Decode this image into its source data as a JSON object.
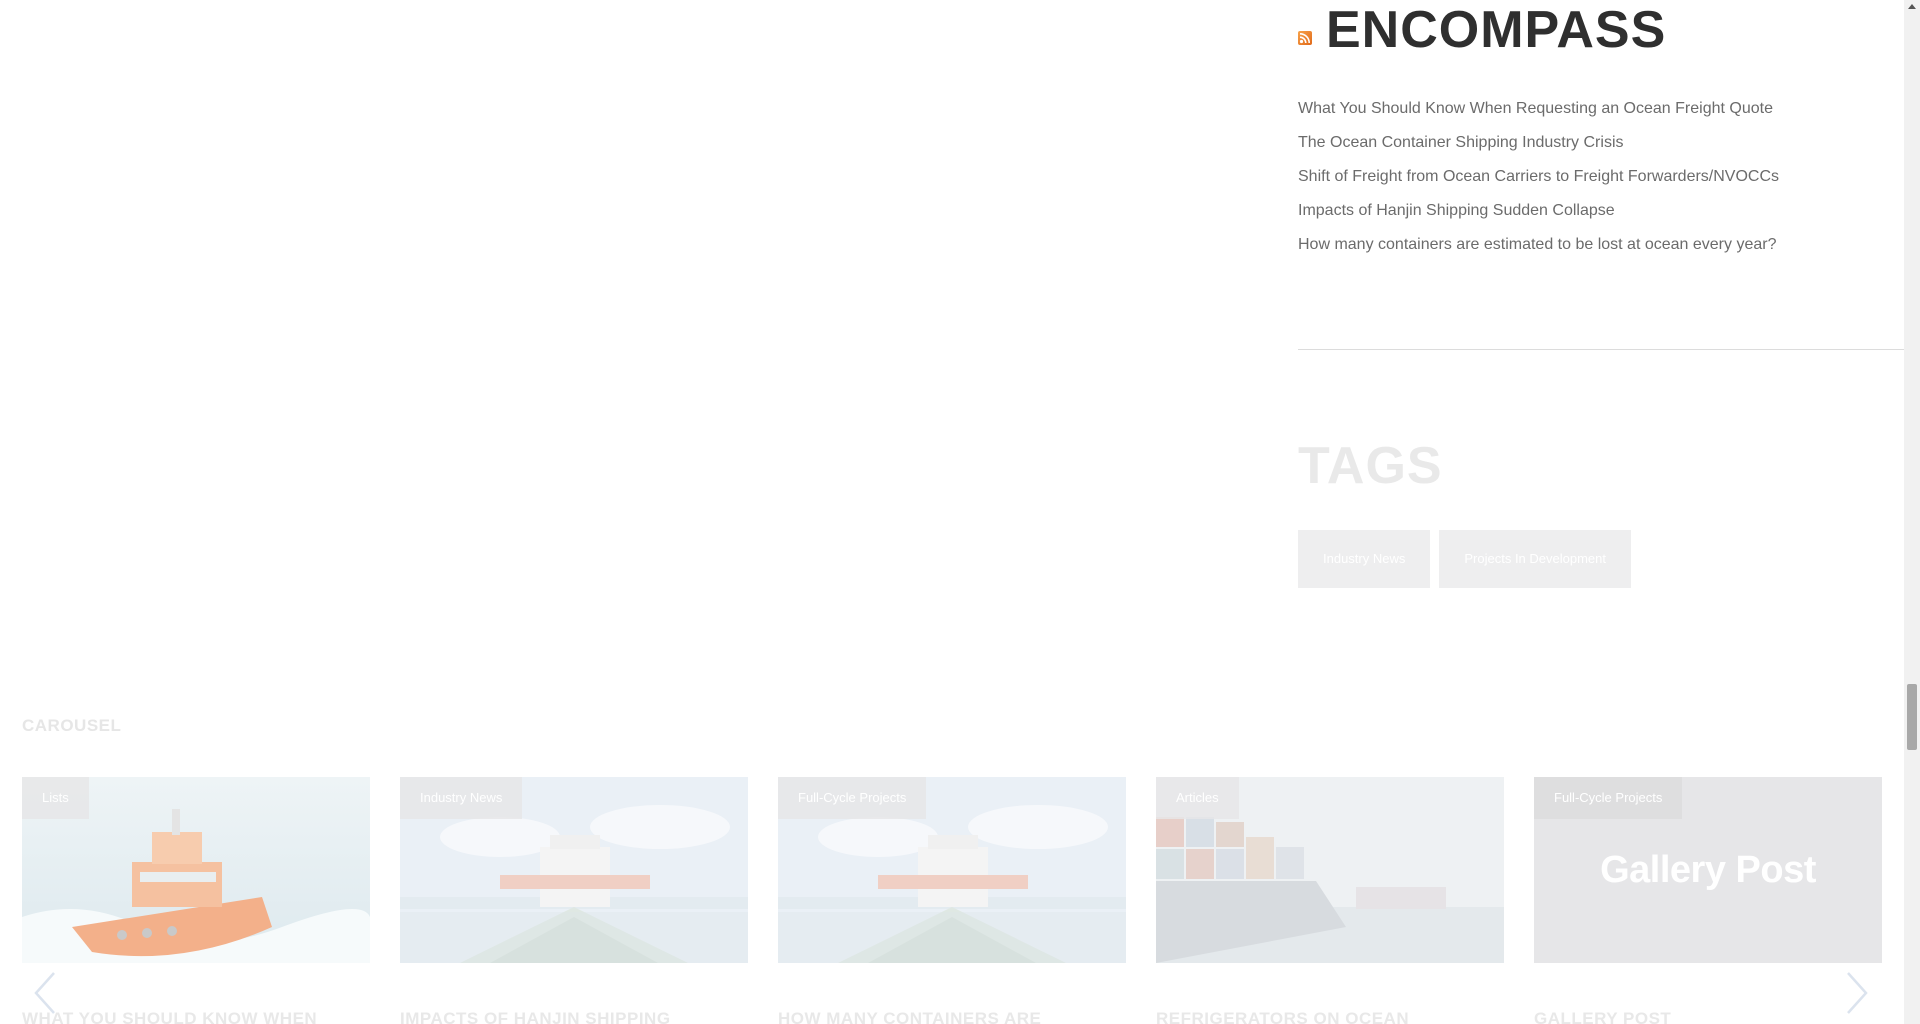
{
  "rss_widget": {
    "title": "ENCOMPASS",
    "icon": "rss-icon",
    "items": [
      "What You Should Know When Requesting an Ocean Freight Quote",
      "The Ocean Container Shipping Industry Crisis",
      "Shift of Freight from Ocean Carriers to Freight Forwarders/NVOCCs",
      "Impacts of Hanjin Shipping Sudden Collapse",
      "How many containers are estimated to be lost at ocean every year?"
    ]
  },
  "tags_widget": {
    "title": "TAGS",
    "tags": [
      "Industry News",
      "Projects In Development"
    ]
  },
  "carousel": {
    "heading": "CAROUSEL",
    "prev_icon": "chevron-left-icon",
    "next_icon": "chevron-right-icon",
    "cards": [
      {
        "category": "Lists",
        "title": "WHAT YOU SHOULD KNOW WHEN",
        "image": "orange-boat-image"
      },
      {
        "category": "Industry News",
        "title": "IMPACTS OF HANJIN SHIPPING",
        "image": "ship-deck-image"
      },
      {
        "category": "Full-Cycle Projects",
        "title": "HOW MANY CONTAINERS ARE",
        "image": "ship-deck-image"
      },
      {
        "category": "Articles",
        "title": "REFRIGERATORS ON OCEAN",
        "image": "container-ship-image"
      },
      {
        "category": "Full-Cycle Projects",
        "title": "GALLERY POST",
        "image_text": "Gallery Post"
      }
    ]
  },
  "colors": {
    "rss_orange": "#e9762b",
    "title_dark": "#2f2f2f",
    "link_gray": "#6b6b6b",
    "faded": "#e9e9e9"
  }
}
